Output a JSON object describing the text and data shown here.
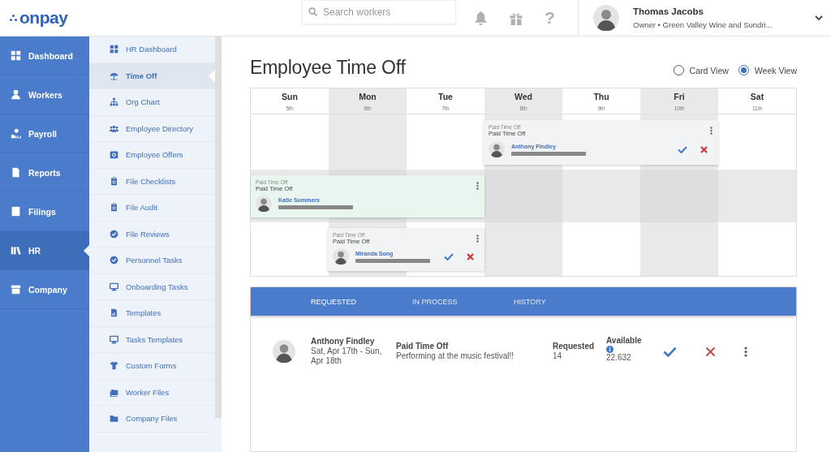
{
  "header": {
    "logo": "onpay",
    "search": {
      "placeholder": "Search workers"
    },
    "help_icon": "?",
    "user": {
      "name": "Thomas Jacobs",
      "subtitle": "Owner • Green Valley Wine and Sundri..."
    }
  },
  "nav": [
    {
      "label": "Dashboard",
      "selected": false
    },
    {
      "label": "Workers",
      "selected": false
    },
    {
      "label": "Payroll",
      "selected": false
    },
    {
      "label": "Reports",
      "selected": false
    },
    {
      "label": "Filings",
      "selected": false
    },
    {
      "label": "HR",
      "selected": true
    },
    {
      "label": "Company",
      "selected": false
    }
  ],
  "subnav": [
    {
      "label": "HR Dashboard",
      "selected": false
    },
    {
      "label": "Time Off",
      "selected": true
    },
    {
      "label": "Org Chart",
      "selected": false
    },
    {
      "label": "Employee Directory",
      "selected": false
    },
    {
      "label": "Employee Offers",
      "selected": false
    },
    {
      "label": "File Checklists",
      "selected": false
    },
    {
      "label": "File Audit",
      "selected": false
    },
    {
      "label": "File Reviews",
      "selected": false
    },
    {
      "label": "Personnel Tasks",
      "selected": false
    },
    {
      "label": "Onboarding Tasks",
      "selected": false
    },
    {
      "label": "Templates",
      "selected": false
    },
    {
      "label": "Tasks Templates",
      "selected": false
    },
    {
      "label": "Custom Forms",
      "selected": false
    },
    {
      "label": "Worker Files",
      "selected": false
    },
    {
      "label": "Company Files",
      "selected": false
    }
  ],
  "page_title": "Employee Time Off",
  "view_options": [
    {
      "label": "Card View",
      "selected": false
    },
    {
      "label": "Week View",
      "selected": true
    }
  ],
  "calendar": {
    "days": [
      {
        "name": "Sun",
        "date": "5th",
        "shaded": false
      },
      {
        "name": "Mon",
        "date": "6th",
        "shaded": true
      },
      {
        "name": "Tue",
        "date": "7th",
        "shaded": false
      },
      {
        "name": "Wed",
        "date": "8th",
        "shaded": true
      },
      {
        "name": "Thu",
        "date": "9th",
        "shaded": false
      },
      {
        "name": "Fri",
        "date": "10th",
        "shaded": true
      },
      {
        "name": "Sat",
        "date": "11th",
        "shaded": false
      }
    ],
    "rows": [
      {
        "shaded": false,
        "slots": [
          {
            "kind": "empty"
          },
          {
            "kind": "empty"
          },
          {
            "kind": "empty"
          },
          {
            "kind": "event",
            "approved": false,
            "category": "Paid Time Off",
            "type": "Paid Time Off",
            "name": "Anthony Findley"
          },
          {
            "kind": "continued"
          },
          {
            "kind": "continued"
          },
          {
            "kind": "empty"
          }
        ]
      },
      {
        "shaded": true,
        "slots": [
          {
            "kind": "event",
            "approved": true,
            "category": "Paid Time Off",
            "type": "Paid Time Off",
            "name": "Katie Summers"
          },
          {
            "kind": "continued"
          },
          {
            "kind": "continued"
          },
          {
            "kind": "empty"
          },
          {
            "kind": "empty"
          },
          {
            "kind": "empty"
          },
          {
            "kind": "empty"
          }
        ]
      },
      {
        "shaded": false,
        "slots": [
          {
            "kind": "empty"
          },
          {
            "kind": "event",
            "approved": false,
            "category": "Paid Time Off",
            "type": "Paid Time Off",
            "name": "Miranda Song"
          },
          {
            "kind": "continued"
          },
          {
            "kind": "empty"
          },
          {
            "kind": "empty"
          },
          {
            "kind": "empty"
          },
          {
            "kind": "empty"
          }
        ]
      }
    ]
  },
  "requests": {
    "tabs": [
      {
        "label": "REQUESTED",
        "selected": true
      },
      {
        "label": "IN PROCESS",
        "selected": false
      },
      {
        "label": "HISTORY",
        "selected": false
      }
    ],
    "items": [
      {
        "name": "Anthony Findley",
        "dates": "Sat, Apr 17th - Sun, Apr 18th",
        "type": "Paid Time Off",
        "note": "Performing at the music festival!!",
        "requested_label": "Requested",
        "requested_value": "14",
        "available_label": "Available",
        "available_value": "22.632"
      }
    ]
  }
}
